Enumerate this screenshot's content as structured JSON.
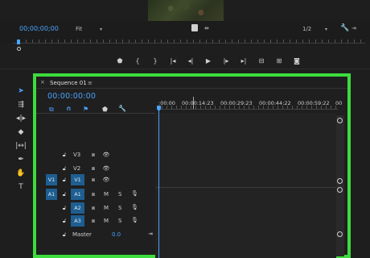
{
  "monitor": {
    "timecode": "00;00;00;00",
    "fit": "Fit",
    "fit_arrow": "▾",
    "resolution": "1/2",
    "resolution_arrow": "▾",
    "controls": [
      "⏷",
      "{",
      "}",
      "|◀",
      "◀|",
      "▶",
      "|▶",
      "▶|",
      "⎘",
      "⎗",
      "📷"
    ]
  },
  "tools": [
    "selection-tool",
    "track-select-tool",
    "ripple-edit-tool",
    "razor-tool",
    "slip-tool",
    "pen-tool",
    "hand-tool",
    "type-tool"
  ],
  "timeline": {
    "tab_close": "×",
    "tab_title": "Sequence 01",
    "tab_menu": "≡",
    "timecode": "00:00:00:00",
    "ruler_labels": [
      ":00:00",
      "00:00:14:23",
      "00:00:29:23",
      "00:00:44:22",
      "00:00:59:22",
      "00"
    ],
    "tracks": [
      {
        "source": "",
        "lock": "🔓",
        "target": "",
        "name": "V3",
        "type": "video"
      },
      {
        "source": "",
        "lock": "🔓",
        "target": "",
        "name": "V2",
        "type": "video"
      },
      {
        "source": "V1",
        "lock": "🔓",
        "target": "V1",
        "name": "",
        "type": "video"
      },
      {
        "source": "A1",
        "lock": "🔓",
        "target": "A1",
        "name": "",
        "type": "audio"
      },
      {
        "source": "",
        "lock": "🔓",
        "target": "A2",
        "name": "",
        "type": "audio"
      },
      {
        "source": "",
        "lock": "🔓",
        "target": "A3",
        "name": "",
        "type": "audio"
      }
    ],
    "master_label": "Master",
    "master_value": "0.0",
    "mute": "M",
    "solo": "S"
  },
  "colors": {
    "accent": "#4aa3ff",
    "highlight_border": "#3ddb3d",
    "track_blue": "#1e5e90"
  }
}
